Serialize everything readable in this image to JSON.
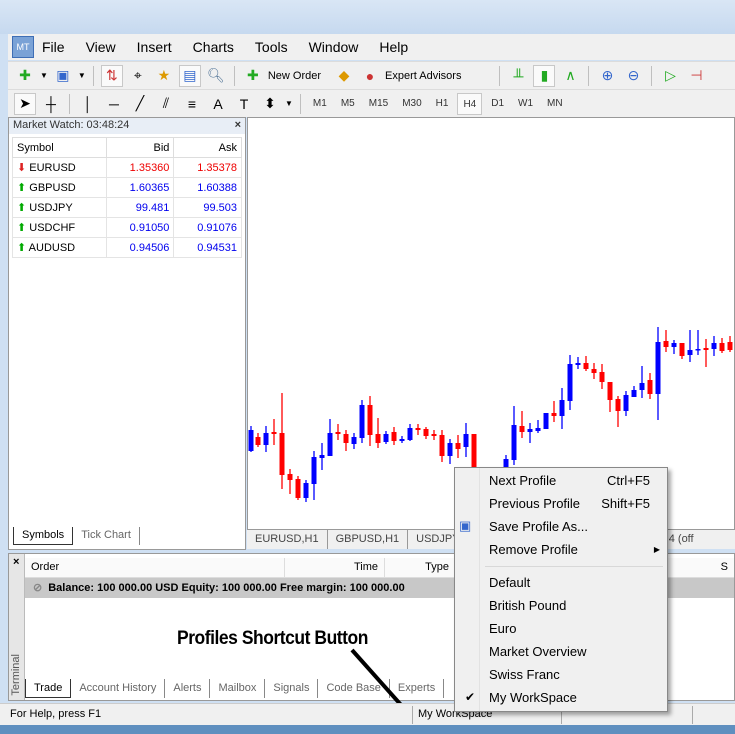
{
  "menu": [
    "File",
    "View",
    "Insert",
    "Charts",
    "Tools",
    "Window",
    "Help"
  ],
  "toolbar": {
    "new_order": "New Order",
    "expert_advisors": "Expert Advisors",
    "timeframes": [
      "M1",
      "M5",
      "M15",
      "M30",
      "H1",
      "H4",
      "D1",
      "W1",
      "MN"
    ],
    "active_timeframe": "H4"
  },
  "market_watch": {
    "title": "Market Watch: 03:48:24",
    "columns": [
      "Symbol",
      "Bid",
      "Ask"
    ],
    "rows": [
      {
        "symbol": "EURUSD",
        "bid": "1.35360",
        "ask": "1.35378",
        "dir": "down",
        "color": "red"
      },
      {
        "symbol": "GBPUSD",
        "bid": "1.60365",
        "ask": "1.60388",
        "dir": "up",
        "color": "blue"
      },
      {
        "symbol": "USDJPY",
        "bid": "99.481",
        "ask": "99.503",
        "dir": "up",
        "color": "blue"
      },
      {
        "symbol": "USDCHF",
        "bid": "0.91050",
        "ask": "0.91076",
        "dir": "up",
        "color": "blue"
      },
      {
        "symbol": "AUDUSD",
        "bid": "0.94506",
        "ask": "0.94531",
        "dir": "up",
        "color": "blue"
      }
    ],
    "tabs": [
      "Symbols",
      "Tick Chart"
    ]
  },
  "chart_tabs": [
    "EURUSD,H1",
    "GBPUSD,H1",
    "USDJPY",
    "RUSD,H4 (off"
  ],
  "terminal": {
    "label": "Terminal",
    "columns": [
      "Order",
      "Time",
      "Type",
      "S",
      "S"
    ],
    "balance": "Balance: 100 000.00 USD  Equity: 100 000.00  Free margin: 100 000.00",
    "tabs": [
      "Trade",
      "Account History",
      "Alerts",
      "Mailbox",
      "Signals",
      "Code Base",
      "Experts"
    ]
  },
  "annotation": "Profiles Shortcut Button",
  "status": {
    "help": "For Help, press F1",
    "profile": "My WorkSpace"
  },
  "context_menu": {
    "items": [
      {
        "label": "Next Profile",
        "shortcut": "Ctrl+F5"
      },
      {
        "label": "Previous Profile",
        "shortcut": "Shift+F5"
      },
      {
        "label": "Save Profile As..."
      },
      {
        "label": "Remove Profile"
      }
    ],
    "profiles": [
      "Default",
      "British Pound",
      "Euro",
      "Market Overview",
      "Swiss Franc",
      "My WorkSpace"
    ],
    "checked": "My WorkSpace"
  },
  "colors": {
    "bull": "#0000ff",
    "bear": "#ff0000",
    "balance_row": "#c8c8c8"
  }
}
